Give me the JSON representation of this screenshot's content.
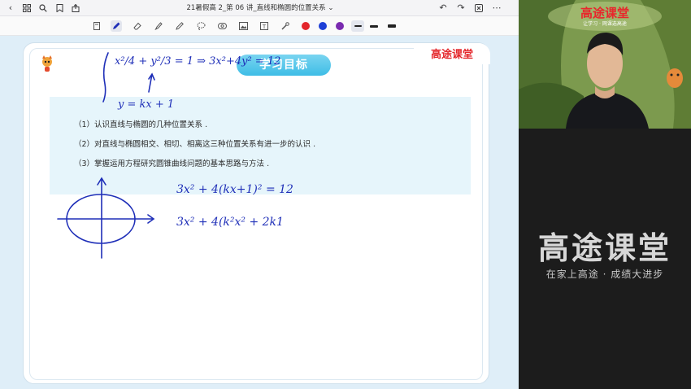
{
  "window": {
    "document_title": "21暑假高 2_第 06 讲_直线和椭圆的位置关系",
    "title_chevron": "⌄"
  },
  "topbar_icons": [
    "back-icon",
    "grid-icon",
    "search-icon",
    "bookmark-icon",
    "share-icon",
    "undo-icon",
    "redo-icon",
    "export-icon",
    "more-icon"
  ],
  "toolbar": {
    "tools": [
      "page-icon",
      "pen-icon",
      "eraser-icon",
      "highlighter-icon",
      "pencil-icon",
      "lasso-icon",
      "shapes-icon",
      "image-icon",
      "text-icon",
      "laser-icon"
    ],
    "colors": [
      "#e3262b",
      "#1e3fd6",
      "#7a2bb0"
    ],
    "stroke_widths": [
      "thin",
      "medium",
      "thick"
    ]
  },
  "page": {
    "brand_tab": "高途课堂",
    "goal_title": "学习目标",
    "goals": [
      "（1）认识直线与椭圆的几种位置关系 .",
      "（2）对直线与椭圆相交、相切、相离这三种位置关系有进一步的认识 .",
      "（3）掌握运用方程研究圆锥曲线问题的基本思路与方法 ."
    ],
    "ink_color": "#1f2fb8",
    "handwriting": {
      "system_line1": "x²/4 + y²/3 = 1 ⇒ 3x²+4y² = 12",
      "system_line2": "y = kx + 1",
      "work_line1": "3x² + 4(kx+1)² = 12",
      "work_line2": "3x² + 4(k²x² + 2k1"
    }
  },
  "video": {
    "brand": "高途课堂",
    "slogan": "让学习 · 网课选高途"
  },
  "sidepanel": {
    "brand": "高途课堂",
    "slogan": "在家上高途 · 成绩大进步"
  }
}
